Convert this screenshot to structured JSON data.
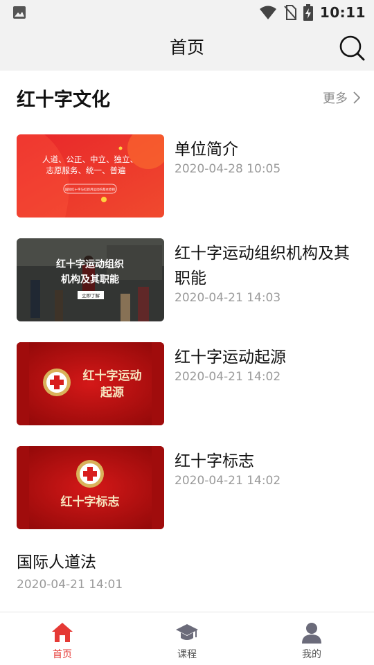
{
  "status_bar": {
    "time": "10:11",
    "icons": [
      "image-icon",
      "wifi-icon",
      "no-sim-icon",
      "battery-charging-icon"
    ]
  },
  "header": {
    "title": "首页",
    "search_icon": "search-icon"
  },
  "section": {
    "title": "红十字文化",
    "more_label": "更多"
  },
  "articles": [
    {
      "title": "单位简介",
      "date": "2020-04-28 10:05",
      "thumb_text": [
        "人道、公正、中立、独立、",
        "志愿服务、统一、普遍"
      ],
      "thumb_button": "国际红十字与红新月运动的基本原则"
    },
    {
      "title": "红十字运动组织机构及其职能",
      "date": "2020-04-21 14:03",
      "thumb_text": [
        "红十字运动组织",
        "机构及其职能"
      ],
      "thumb_button": "立即了解"
    },
    {
      "title": "红十字运动起源",
      "date": "2020-04-21 14:02",
      "thumb_text": [
        "红十字运动",
        "起源"
      ]
    },
    {
      "title": "红十字标志",
      "date": "2020-04-21 14:02",
      "thumb_text": [
        "红十字标志"
      ]
    },
    {
      "title": "国际人道法",
      "date": "2020-04-21 14:01"
    }
  ],
  "tabs": [
    {
      "label": "首页",
      "icon": "home-icon",
      "active": true
    },
    {
      "label": "课程",
      "icon": "graduation-cap-icon",
      "active": false
    },
    {
      "label": "我的",
      "icon": "user-icon",
      "active": false
    }
  ],
  "colors": {
    "accent": "#e53935",
    "bar_bg": "#f2f2f2",
    "muted": "#9a9a9a",
    "tab_inactive": "#6b6b7a"
  }
}
